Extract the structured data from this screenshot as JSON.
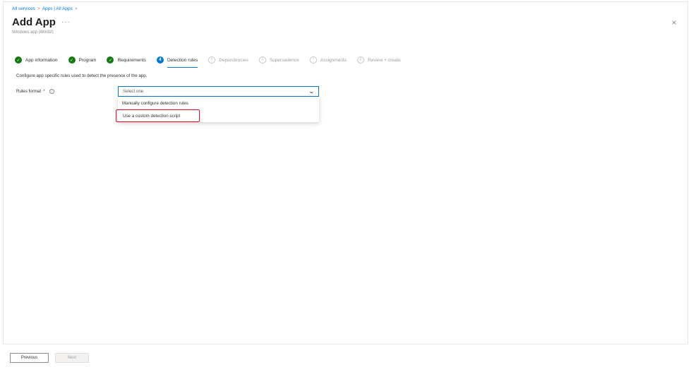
{
  "breadcrumb": [
    "All services",
    "Apps | All Apps"
  ],
  "breadcrumb_separator": ">",
  "page": {
    "title": "Add App",
    "more_label": "···",
    "subtitle": "Windows app (Win32)",
    "close_label": "×"
  },
  "steps": [
    {
      "label": "App information",
      "status": "done",
      "icon": "checkmark-icon",
      "glyph": "✓"
    },
    {
      "label": "Program",
      "status": "done",
      "icon": "checkmark-icon",
      "glyph": "✓"
    },
    {
      "label": "Requirements",
      "status": "done",
      "icon": "checkmark-icon",
      "glyph": "✓"
    },
    {
      "label": "Detection rules",
      "status": "active",
      "icon": "step-number-icon",
      "glyph": "4"
    },
    {
      "label": "Dependencies",
      "status": "pending",
      "icon": "step-number-icon",
      "glyph": "5"
    },
    {
      "label": "Supersedence",
      "status": "pending",
      "icon": "step-number-icon",
      "glyph": "6"
    },
    {
      "label": "Assignments",
      "status": "pending",
      "icon": "step-number-icon",
      "glyph": "7"
    },
    {
      "label": "Review + create",
      "status": "pending",
      "icon": "step-number-icon",
      "glyph": "8"
    }
  ],
  "form": {
    "description": "Configure app specific rules used to detect the presence of the app.",
    "rules_format_label": "Rules format",
    "required_marker": "*",
    "info_glyph": "i",
    "dropdown_value": "Select one",
    "dropdown_options": [
      "Manually configure detection rules",
      "Use a custom detection script"
    ]
  },
  "footer": {
    "previous_label": "Previous",
    "next_label": "Next"
  },
  "colors": {
    "accent": "#0078d4",
    "success": "#107c10",
    "highlight_border": "#e81123"
  }
}
